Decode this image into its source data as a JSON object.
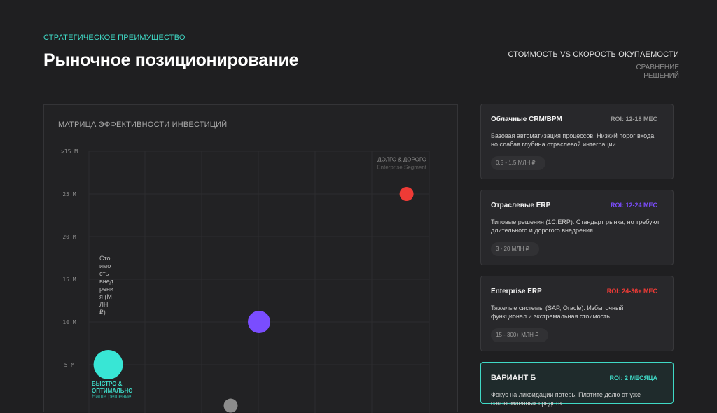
{
  "header": {
    "eyebrow": "СТРАТЕГИЧЕСКОЕ ПРЕИМУЩЕСТВО",
    "title": "Рыночное позиционирование",
    "subtitle": "СТОИМОСТЬ VS СКОРОСТЬ ОКУПАЕМОСТИ",
    "note_line1": "СРАВНЕНИЕ",
    "note_line2": "РЕШЕНИЙ"
  },
  "chart_panel": {
    "title": "МАТРИЦА ЭФФЕКТИВНОСТИ ИНВЕСТИЦИЙ"
  },
  "chart_data": {
    "type": "scatter",
    "title": "МАТРИЦА ЭФФЕКТИВНОСТИ ИНВЕСТИЦИЙ",
    "ylabel": "Стоимость внедрения (МЛН ₽)",
    "xlabel": "",
    "y_ticks": [
      "5 М",
      "10 М",
      "15 М",
      "20 М",
      "25 М",
      ">15 М"
    ],
    "ylim": [
      0,
      30
    ],
    "xlim": [
      0,
      30
    ],
    "grid": true,
    "points": [
      {
        "x": 28.0,
        "y": 25,
        "size": "small",
        "color": "#ef3b36"
      },
      {
        "x": 15.0,
        "y": 10,
        "size": "medium",
        "color": "#7a4dff"
      },
      {
        "x": 1.7,
        "y": 5,
        "size": "large",
        "color": "#38e6d5"
      },
      {
        "x": 12.5,
        "y": 0.2,
        "size": "small",
        "color": "#8c8c8c"
      }
    ],
    "annotations": [
      {
        "label": "ДОЛГО & ДОРОГО",
        "sublabel": "Enterprise Segment",
        "x": 30,
        "y": 28.5
      },
      {
        "label": "БЫСТРО & ОПТИМАЛЬНО",
        "sublabel": "Наше решение",
        "x": 0.3,
        "y": 2.0
      }
    ]
  },
  "cards": [
    {
      "name": "Облачные CRM/BPM",
      "roi": "ROI: 12-18 МЕС",
      "roi_color": "#9a9a9a",
      "desc": "Базовая автоматизация процессов. Низкий порог входа, но слабая глубина отраслевой интеграции.",
      "price": "0.5 - 1.5 МЛН ₽"
    },
    {
      "name": "Отраслевые ERP",
      "roi": "ROI: 12-24 МЕС",
      "roi_color": "#7c4dff",
      "desc": "Типовые решения (1С:ERP). Стандарт рынка, но требуют длительного и дорогого внедрения.",
      "price": "3 - 20 МЛН ₽"
    },
    {
      "name": "Enterprise ERP",
      "roi": "ROI: 24-36+ МЕС",
      "roi_color": "#ef3b36",
      "desc": "Тяжелые системы (SAP, Oracle). Избыточный функционал и экстремальная стоимость.",
      "price": "15 - 300+ МЛН ₽"
    },
    {
      "name": "ВАРИАНТ Б",
      "roi": "ROI: 2 МЕСЯЦА",
      "roi_color": "#3fd9c6",
      "desc": "Фокус на ликвидации потерь. Платите долю от уже сэкономленных средств."
    }
  ]
}
